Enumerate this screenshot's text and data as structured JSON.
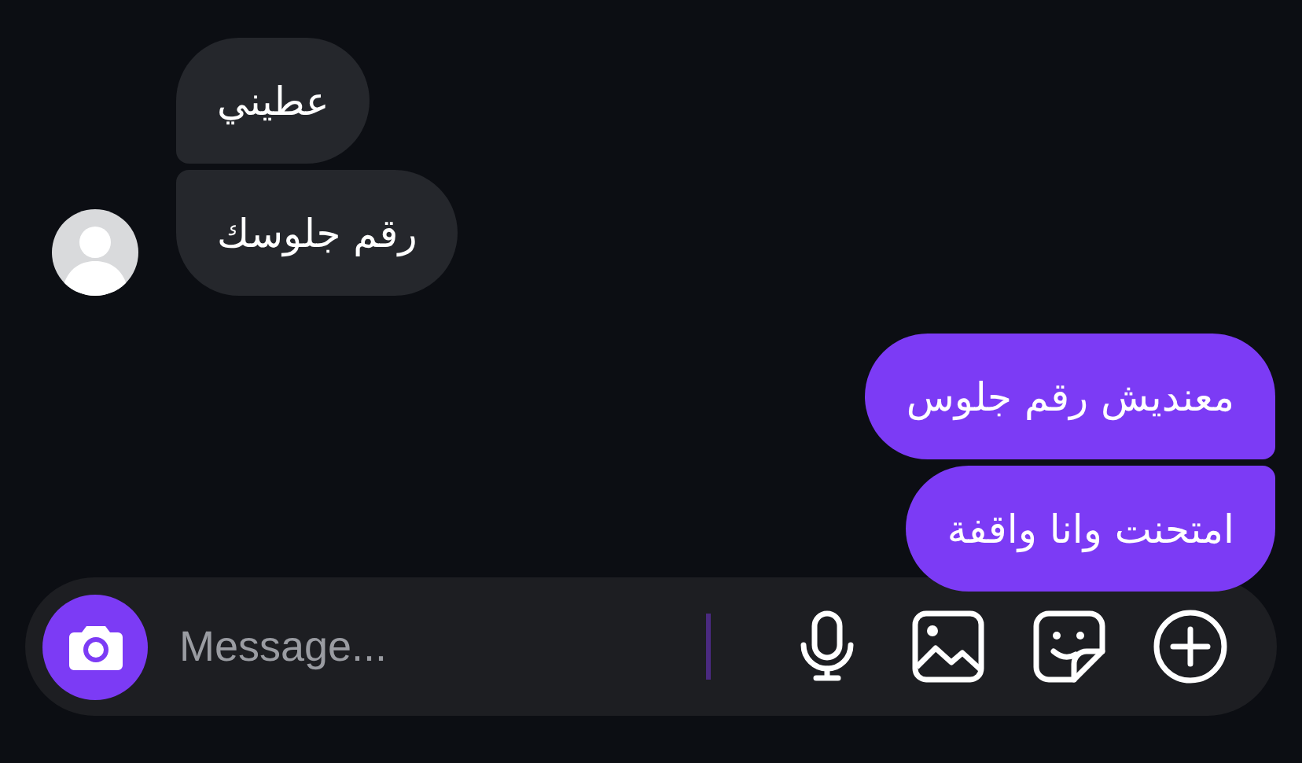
{
  "thread": [
    {
      "kind": "incoming",
      "messages": [
        "عطيني",
        "رقم جلوسك"
      ]
    },
    {
      "kind": "outgoing",
      "messages": [
        "معنديش رقم جلوس",
        "امتحنت وانا واقفة"
      ]
    }
  ],
  "composer": {
    "placeholder": "Message..."
  }
}
